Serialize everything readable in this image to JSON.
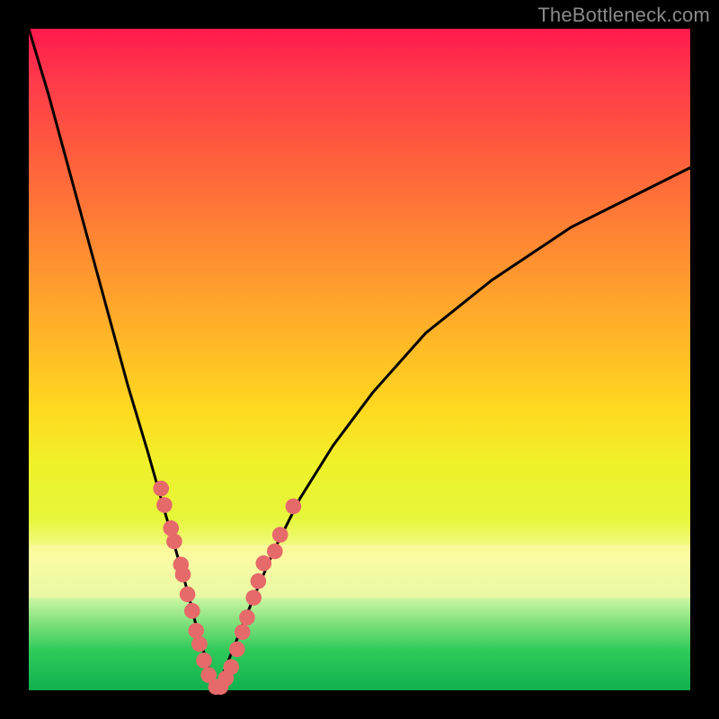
{
  "watermark": "TheBottleneck.com",
  "colors": {
    "frame": "#000000",
    "curve": "#000000",
    "dots": "#e66a6a",
    "gradient_stops": [
      "#ff1a4d",
      "#ff7a36",
      "#ffda20",
      "#f6fca0",
      "#2fca5a",
      "#0fb14e"
    ]
  },
  "chart_data": {
    "type": "line",
    "title": "",
    "xlabel": "",
    "ylabel": "",
    "xlim": [
      0,
      100
    ],
    "ylim": [
      0,
      100
    ],
    "grid": false,
    "legend": false,
    "background": "red-to-green vertical gradient (red top, green bottom) with pale yellow band near y≈18–24",
    "series": [
      {
        "name": "left-curve",
        "x": [
          0,
          3,
          6,
          9,
          12,
          15,
          18,
          20,
          22,
          24,
          25.5,
          27,
          28.3
        ],
        "y": [
          100,
          90,
          79,
          68,
          57,
          46,
          36,
          29,
          22,
          15,
          9,
          4,
          0
        ]
      },
      {
        "name": "right-curve",
        "x": [
          28.3,
          30,
          32,
          34,
          37,
          41,
          46,
          52,
          60,
          70,
          82,
          94,
          100
        ],
        "y": [
          0,
          4,
          9,
          14,
          21,
          29,
          37,
          45,
          54,
          62,
          70,
          76,
          79
        ]
      }
    ],
    "highlight_dots": {
      "color": "#e66a6a",
      "radius_approx": 1.2,
      "points": [
        {
          "x": 20.0,
          "y": 30.5
        },
        {
          "x": 20.5,
          "y": 28.0
        },
        {
          "x": 21.5,
          "y": 24.5
        },
        {
          "x": 22.0,
          "y": 22.5
        },
        {
          "x": 23.0,
          "y": 19.0
        },
        {
          "x": 23.3,
          "y": 17.5
        },
        {
          "x": 24.0,
          "y": 14.5
        },
        {
          "x": 24.7,
          "y": 12.0
        },
        {
          "x": 25.3,
          "y": 9.0
        },
        {
          "x": 25.8,
          "y": 7.0
        },
        {
          "x": 26.5,
          "y": 4.5
        },
        {
          "x": 27.2,
          "y": 2.3
        },
        {
          "x": 28.3,
          "y": 0.5
        },
        {
          "x": 29.0,
          "y": 0.5
        },
        {
          "x": 29.8,
          "y": 1.8
        },
        {
          "x": 30.6,
          "y": 3.5
        },
        {
          "x": 31.5,
          "y": 6.2
        },
        {
          "x": 32.3,
          "y": 8.8
        },
        {
          "x": 33.0,
          "y": 11.0
        },
        {
          "x": 34.0,
          "y": 14.0
        },
        {
          "x": 34.7,
          "y": 16.5
        },
        {
          "x": 35.5,
          "y": 19.2
        },
        {
          "x": 37.2,
          "y": 21.0
        },
        {
          "x": 38.0,
          "y": 23.5
        },
        {
          "x": 40.0,
          "y": 27.8
        }
      ]
    }
  }
}
